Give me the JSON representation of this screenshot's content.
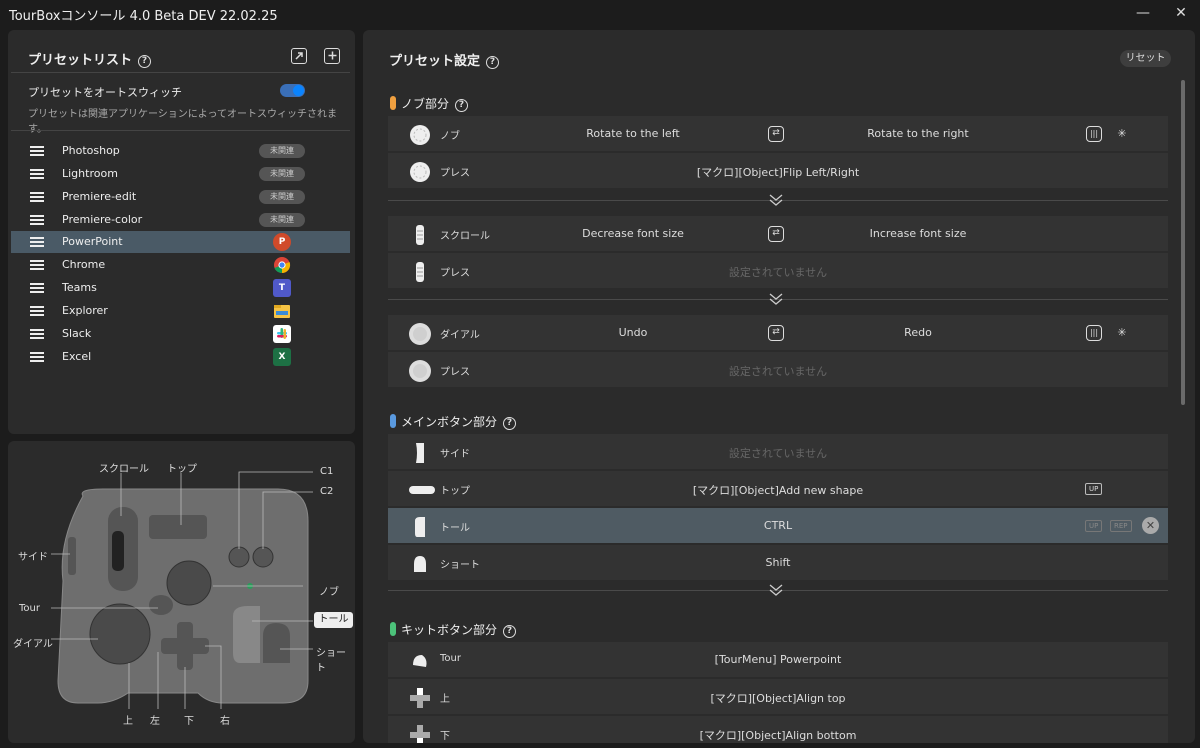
{
  "window": {
    "title": "TourBoxコンソール 4.0 Beta DEV 22.02.25",
    "minimize": "—",
    "close": "✕"
  },
  "preset_list": {
    "header": "プリセットリスト",
    "help": "?",
    "import_icon": "import-icon",
    "add_icon": "plus-icon",
    "auto_switch_title": "プリセットをオートスウィッチ",
    "auto_switch_desc": "プリセットは関連アプリケーションによってオートスウィッチされます。",
    "auto_switch_on": true,
    "items": [
      {
        "name": "Photoshop",
        "badge": "未関連"
      },
      {
        "name": "Lightroom",
        "badge": "未関連"
      },
      {
        "name": "Premiere-edit",
        "badge": "未関連"
      },
      {
        "name": "Premiere-color",
        "badge": "未関連"
      },
      {
        "name": "PowerPoint",
        "icon": "powerpoint-icon"
      },
      {
        "name": "Chrome",
        "icon": "chrome-icon"
      },
      {
        "name": "Teams",
        "icon": "teams-icon"
      },
      {
        "name": "Explorer",
        "icon": "explorer-icon"
      },
      {
        "name": "Slack",
        "icon": "slack-icon"
      },
      {
        "name": "Excel",
        "icon": "excel-icon"
      }
    ],
    "selected": "PowerPoint"
  },
  "device": {
    "labels": {
      "scroll": "スクロール",
      "top": "トップ",
      "c1": "C1",
      "c2": "C2",
      "side": "サイド",
      "knob": "ノブ",
      "tour": "Tour",
      "tall": "トール",
      "dial": "ダイアル",
      "short": "ショート",
      "up": "上",
      "left": "左",
      "down": "下",
      "right": "右"
    }
  },
  "preset_settings": {
    "title": "プリセット設定",
    "help": "?",
    "reset": "リセット",
    "sections": {
      "knob": {
        "title": "ノブ部分",
        "help": "?",
        "color": "#f0a040"
      },
      "main": {
        "title": "メインボタン部分",
        "help": "?",
        "color": "#5a9ae0"
      },
      "kit": {
        "title": "キットボタン部分",
        "help": "?",
        "color": "#4cc27a"
      }
    },
    "rows": {
      "knob_rotate": {
        "name": "ノブ",
        "left": "Rotate to the left",
        "right": "Rotate to the right"
      },
      "knob_press": {
        "name": "プレス",
        "action": "[マクロ][Object]Flip Left/Right"
      },
      "scroll_rotate": {
        "name": "スクロール",
        "left": "Decrease font size",
        "right": "Increase font size"
      },
      "scroll_press": {
        "name": "プレス",
        "action": "設定されていません"
      },
      "dial_rotate": {
        "name": "ダイアル",
        "left": "Undo",
        "right": "Redo"
      },
      "dial_press": {
        "name": "プレス",
        "action": "設定されていません"
      },
      "side": {
        "name": "サイド",
        "action": "設定されていません"
      },
      "top": {
        "name": "トップ",
        "action": "[マクロ][Object]Add new shape",
        "tag": "UP"
      },
      "tall": {
        "name": "トール",
        "action": "CTRL",
        "tag_up": "UP",
        "tag_rep": "REP"
      },
      "short": {
        "name": "ショート",
        "action": "Shift"
      },
      "tour": {
        "name": "Tour",
        "action": "[TourMenu] Powerpoint"
      },
      "up": {
        "name": "上",
        "action": "[マクロ][Object]Align top"
      },
      "down": {
        "name": "下",
        "action": "[マクロ][Object]Align bottom"
      }
    },
    "icons": {
      "swap": "⇄",
      "haptic": "haptic-icon",
      "speed": "speed-icon",
      "remove": "✕",
      "expand": "chevron-down-icon"
    }
  }
}
